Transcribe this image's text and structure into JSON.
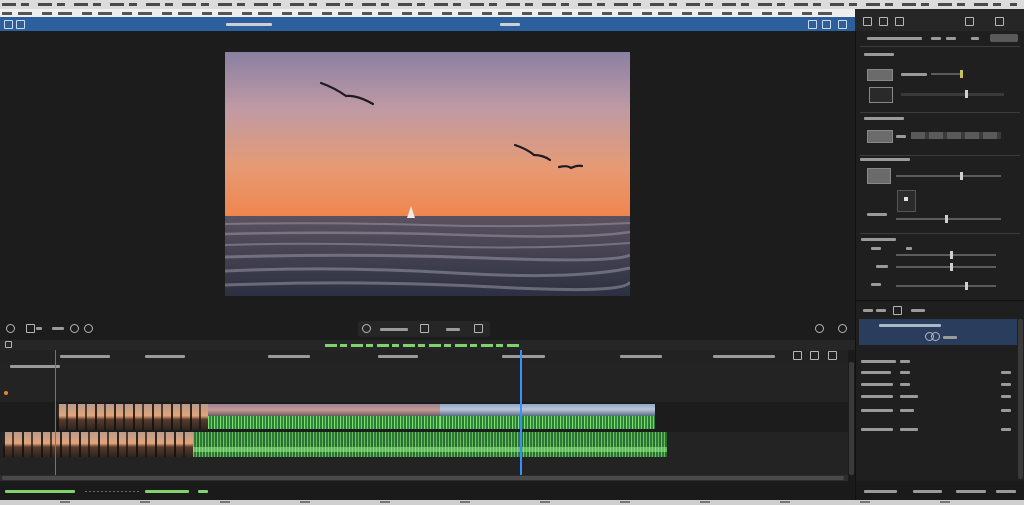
{
  "colors": {
    "title_bar": "#2c5f9e",
    "accent_playhead": "#3a8fff",
    "timecode_text": "#7fd36a",
    "waveform": "#6ed460",
    "selection_row": "#2b3d5c",
    "panel_background": "#1f1f1f"
  },
  "viewer": {
    "left_controls": [
      "settings-icon",
      "zoom-icon",
      "view-options-icon",
      "loop-icon",
      "play-icon"
    ],
    "transport_controls": [
      "play-icon",
      "timecode-display",
      "frame-icon",
      "fullscreen-icon"
    ],
    "right_controls": [
      "audio-meter-icon",
      "fullscreen-icon"
    ]
  },
  "inspector": {
    "slider_values": [
      0.93,
      0.63,
      0.62,
      0.48,
      0.55,
      0.55,
      0.7
    ]
  }
}
